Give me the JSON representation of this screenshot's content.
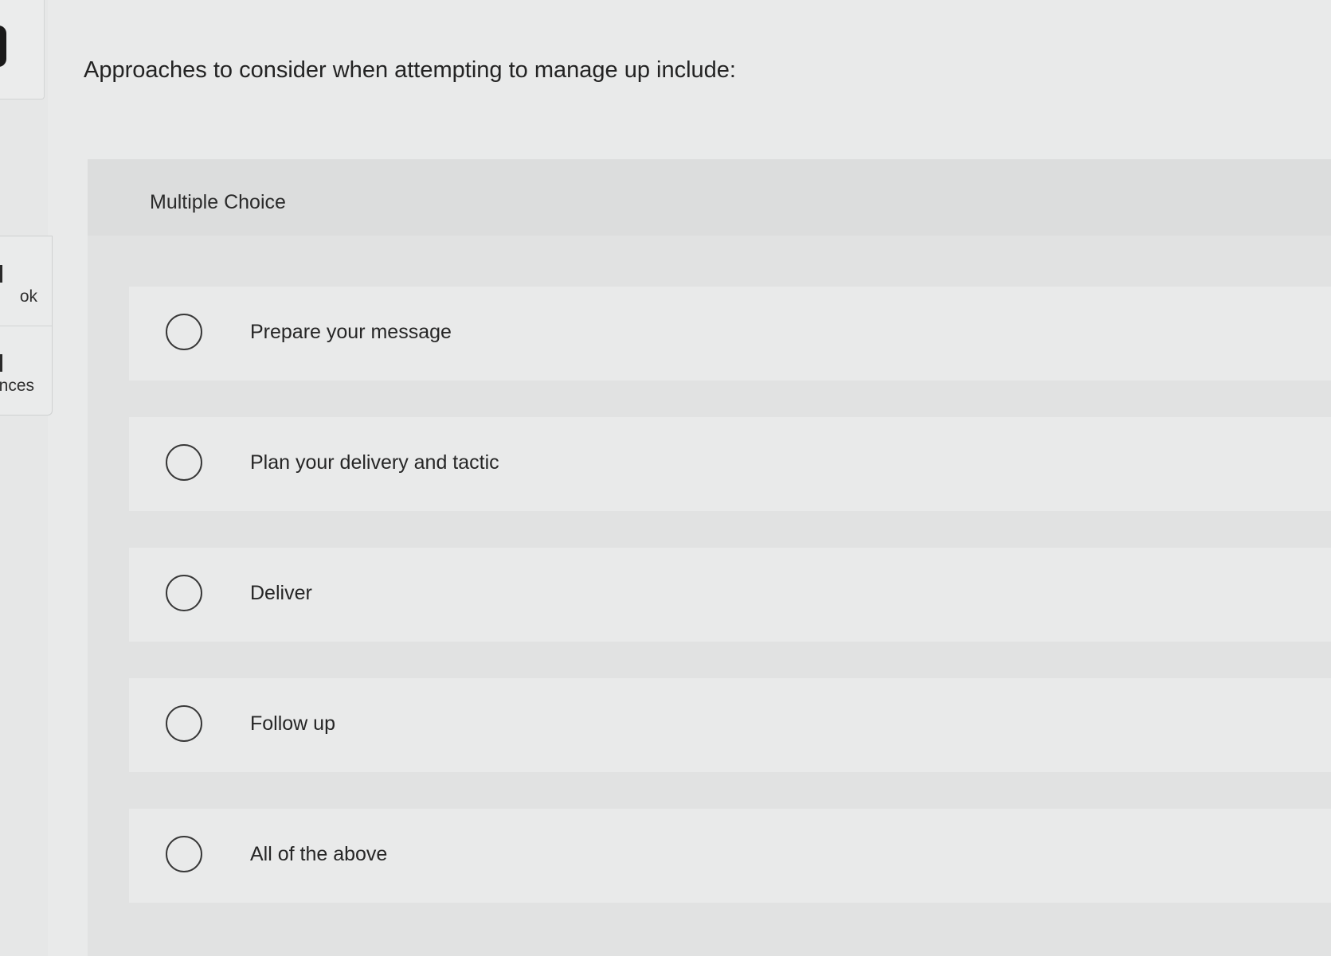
{
  "sidebar": {
    "items": [
      {
        "label": "ok"
      },
      {
        "label": "nces"
      }
    ]
  },
  "question": {
    "text": "Approaches to consider when attempting to manage up include:"
  },
  "card": {
    "type_label": "Multiple Choice"
  },
  "options": [
    {
      "label": "Prepare your message"
    },
    {
      "label": "Plan your delivery and tactic"
    },
    {
      "label": "Deliver"
    },
    {
      "label": "Follow up"
    },
    {
      "label": "All of the above"
    }
  ]
}
